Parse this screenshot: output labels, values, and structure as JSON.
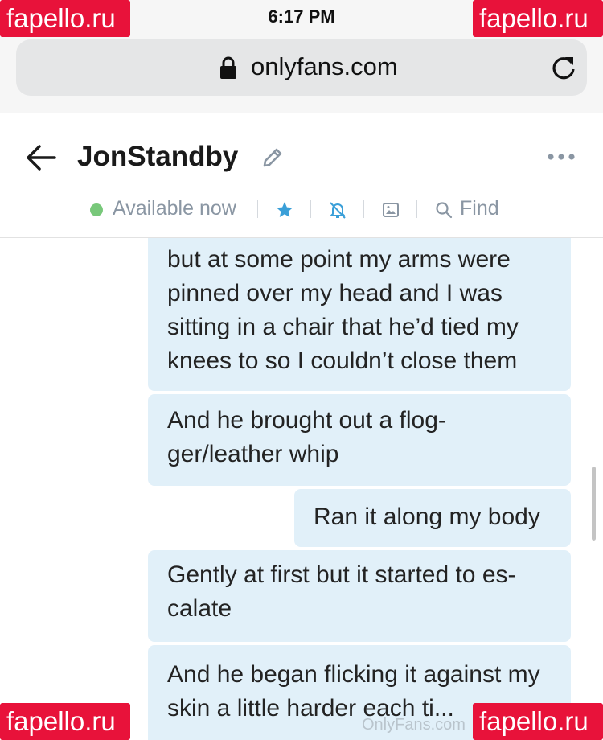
{
  "status_bar": {
    "time": "6:17 PM"
  },
  "browser": {
    "url": "onlyfans.com"
  },
  "header": {
    "username": "JonStandby",
    "status": "Available now",
    "find_label": "Find"
  },
  "messages": [
    {
      "text": "but at some point my arms were pinned over my head and I was sitting in a chair that he’d tied my knees to so I couldn’t close them"
    },
    {
      "text": "And he brought out a flog-ger/leather whip"
    },
    {
      "text": "Ran it along my body"
    },
    {
      "text": "Gently at first but it started to es-calate"
    },
    {
      "text": "And he began flicking it against my skin a little harder each ti..."
    }
  ],
  "watermarks": {
    "site": "fapello.ru",
    "onlyfans": "OnlyFans.com"
  },
  "colors": {
    "bubble": "#e1f0f9",
    "online": "#78c87a",
    "accent": "#00aff0",
    "watermark_tag": "#e8123a"
  },
  "icons": [
    "lock-icon",
    "reload-icon",
    "back-arrow-icon",
    "edit-pencil-icon",
    "more-dots-icon",
    "star-icon",
    "bell-off-icon",
    "image-icon",
    "search-icon"
  ]
}
